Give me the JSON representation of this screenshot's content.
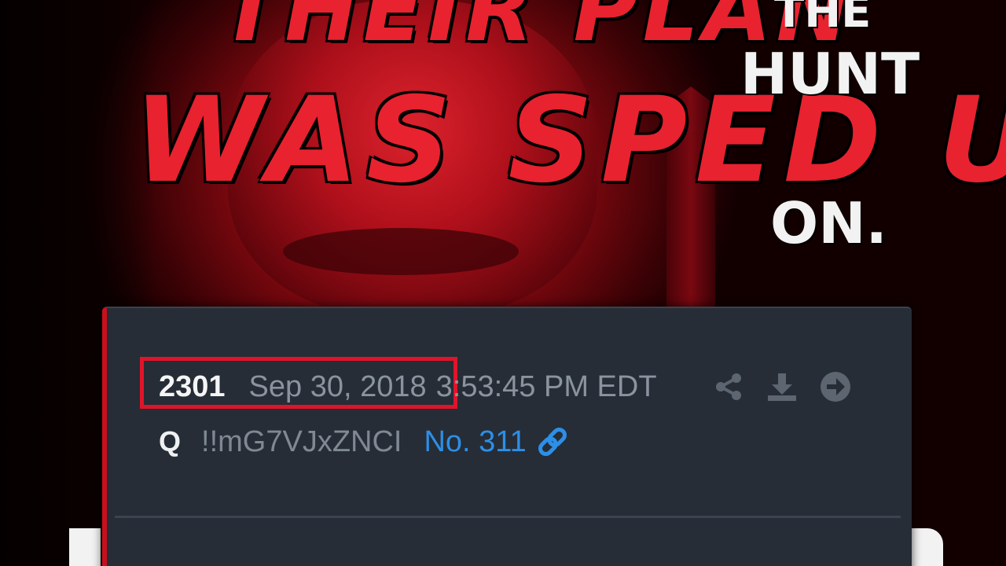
{
  "background": {
    "headline_top": "THEIR PLAN",
    "headline_main": "WAS SPED UP",
    "side_line1": "THE",
    "side_line2": "HUNT",
    "side_line3": "ON.",
    "accent_color": "#e8222f"
  },
  "post": {
    "number": "2301",
    "date": "Sep 30, 2018",
    "time": "3:53:45 PM EDT",
    "author": "Q",
    "tripcode": "!!mG7VJxZNCI",
    "reference": "No. 311",
    "icons": [
      "share-icon",
      "download-icon",
      "arrow-right-circle-icon",
      "link-icon"
    ],
    "highlight_color": "#e0142a",
    "link_color": "#2c8fe8"
  }
}
